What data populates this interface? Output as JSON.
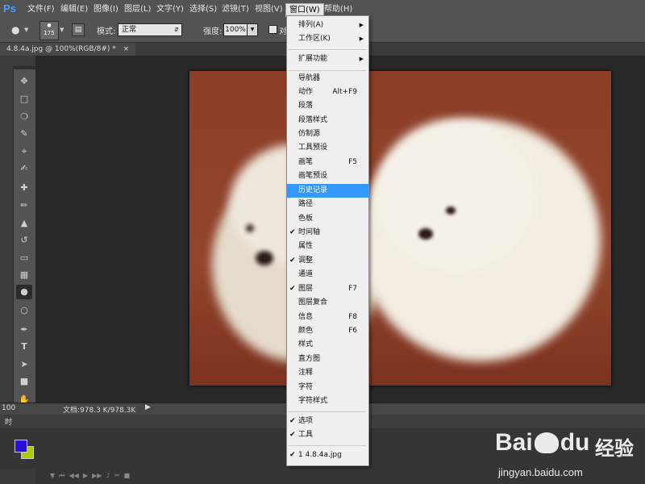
{
  "menubar": {
    "logo": "Ps",
    "items": [
      "文件(F)",
      "编辑(E)",
      "图像(I)",
      "图层(L)",
      "文字(Y)",
      "选择(S)",
      "滤镜(T)",
      "视图(V)",
      "窗口(W)",
      "帮助(H)"
    ]
  },
  "options": {
    "brush_size": "175",
    "mode_label": "模式:",
    "mode_value": "正常",
    "strength_label": "强度:",
    "strength_value": "100%",
    "checkbox_partial": "对"
  },
  "document": {
    "tab_title": "4.8.4a.jpg @ 100%(RGB/8#) *",
    "close": "×"
  },
  "status": {
    "zoom": "100",
    "doc_size": "文档:978.3 K/978.3K"
  },
  "timeline_tab": "时",
  "window_menu": {
    "sections": [
      [
        {
          "label": "排列(A)",
          "submenu": true
        },
        {
          "label": "工作区(K)",
          "submenu": true
        }
      ],
      [
        {
          "label": "扩展功能",
          "submenu": true
        }
      ],
      [
        {
          "label": "导航器"
        },
        {
          "label": "动作",
          "shortcut": "Alt+F9"
        },
        {
          "label": "段落"
        },
        {
          "label": "段落样式"
        },
        {
          "label": "仿制源"
        },
        {
          "label": "工具预设"
        },
        {
          "label": "画笔",
          "shortcut": "F5"
        },
        {
          "label": "画笔预设"
        },
        {
          "label": "历史记录",
          "highlighted": true
        },
        {
          "label": "路径"
        },
        {
          "label": "色板"
        },
        {
          "label": "时间轴",
          "checked": true
        },
        {
          "label": "属性"
        },
        {
          "label": "调整",
          "checked": true
        },
        {
          "label": "通道"
        },
        {
          "label": "图层",
          "shortcut": "F7",
          "checked": true
        },
        {
          "label": "图层复合"
        },
        {
          "label": "信息",
          "shortcut": "F8"
        },
        {
          "label": "颜色",
          "shortcut": "F6"
        },
        {
          "label": "样式"
        },
        {
          "label": "直方图"
        },
        {
          "label": "注释"
        },
        {
          "label": "字符"
        },
        {
          "label": "字符样式"
        }
      ],
      [
        {
          "label": "选项",
          "checked": true
        },
        {
          "label": "工具",
          "checked": true
        }
      ],
      [
        {
          "label": "1 4.8.4a.jpg",
          "checked": true
        }
      ]
    ]
  },
  "watermark": {
    "brand": "Bai",
    "brand2": "du",
    "cn": "经验",
    "url": "jingyan.baidu.com"
  },
  "colors": {
    "foreground": "#2a0fd8",
    "background": "#aacc00",
    "highlight": "#3399ff",
    "photo_bg": "#8b3d27"
  }
}
